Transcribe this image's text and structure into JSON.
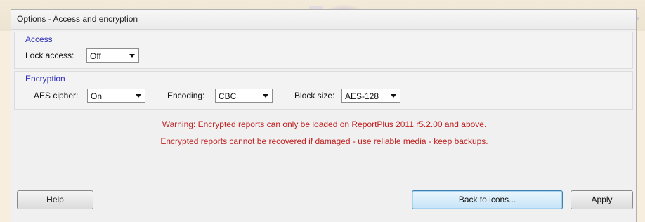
{
  "window": {
    "title": "Options - Access and encryption"
  },
  "access": {
    "group_label": "Access",
    "lock_label": "Lock access:",
    "lock_value": "Off"
  },
  "encryption": {
    "group_label": "Encryption",
    "aes_label": "AES cipher:",
    "aes_value": "On",
    "encoding_label": "Encoding:",
    "encoding_value": "CBC",
    "blocksize_label": "Block size:",
    "blocksize_value": "AES-128"
  },
  "warnings": {
    "line1": "Warning: Encrypted reports can only be loaded on ReportPlus 2011 r5.2.00 and above.",
    "line2": "Encrypted reports cannot be recovered if damaged - use reliable media - keep backups."
  },
  "buttons": {
    "help": "Help",
    "back": "Back to icons...",
    "apply": "Apply"
  },
  "colors": {
    "group_label": "#2e2eb8",
    "warning_text": "#c02020",
    "background": "#f7eedf"
  }
}
